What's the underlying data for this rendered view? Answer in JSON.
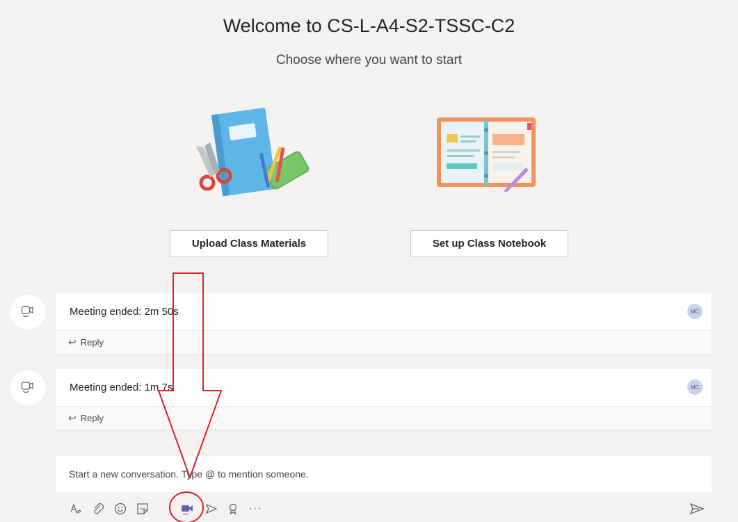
{
  "header": {
    "title": "Welcome to CS-L-A4-S2-TSSC-C2",
    "subtitle": "Choose where you want to start"
  },
  "actions": {
    "upload_label": "Upload Class Materials",
    "notebook_label": "Set up Class Notebook"
  },
  "feed": [
    {
      "icon": "meet-video-icon",
      "text": "Meeting ended: 2m 50s",
      "avatar": "MC",
      "reply_label": "Reply"
    },
    {
      "icon": "meet-video-icon",
      "text": "Meeting ended: 1m 7s",
      "avatar": "MC",
      "reply_label": "Reply"
    }
  ],
  "compose": {
    "placeholder": "Start a new conversation. Type @ to mention someone."
  },
  "toolbar": {
    "icons": [
      "format-icon",
      "attach-icon",
      "emoji-icon",
      "sticker-icon",
      "meet-now-icon",
      "praise-send-icon",
      "praise-icon",
      "more-icon"
    ],
    "more_label": "···",
    "send_icon": "send-icon"
  },
  "colors": {
    "accent": "#6264a7",
    "annotation": "#e02020"
  }
}
